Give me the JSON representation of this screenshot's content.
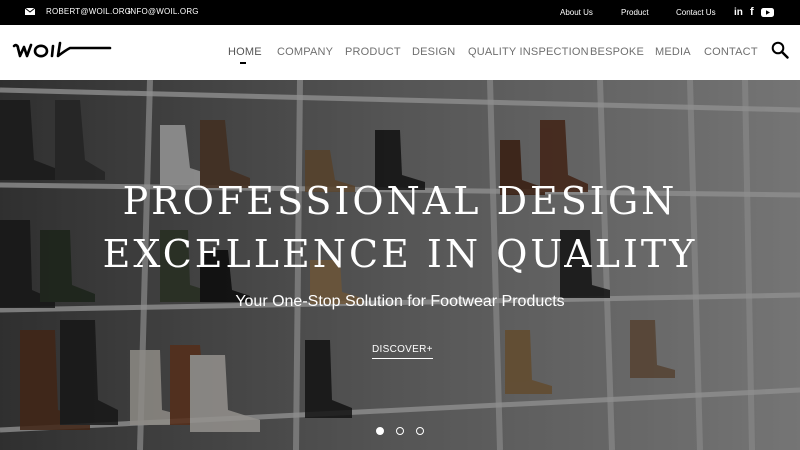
{
  "topbar": {
    "email_1": "ROBERT@WOIL.ORG",
    "email_2": "INFO@WOIL.ORG",
    "links": [
      "About Us",
      "Product",
      "Contact Us"
    ],
    "social": {
      "linkedin": "in",
      "facebook": "f"
    }
  },
  "header": {
    "logo_text": "woil",
    "nav": [
      "HOME",
      "COMPANY",
      "PRODUCT",
      "DESIGN",
      "QUALITY INSPECTION",
      "BESPOKE",
      "MEDIA",
      "CONTACT"
    ],
    "active_nav": "HOME"
  },
  "hero": {
    "headline_1": "PROFESSIONAL DESIGN",
    "headline_2": "EXCELLENCE IN QUALITY",
    "subline": "Your One-Stop Solution for Footwear Products",
    "cta": "DISCOVER+",
    "slides": 3,
    "active_slide": 1
  },
  "colors": {
    "topbar_bg": "#000000",
    "header_bg": "#ffffff",
    "nav_text": "#6f6f6f",
    "hero_text": "#ffffff"
  },
  "icons": [
    "mail-icon",
    "linkedin-icon",
    "facebook-icon",
    "youtube-icon",
    "search-icon"
  ]
}
